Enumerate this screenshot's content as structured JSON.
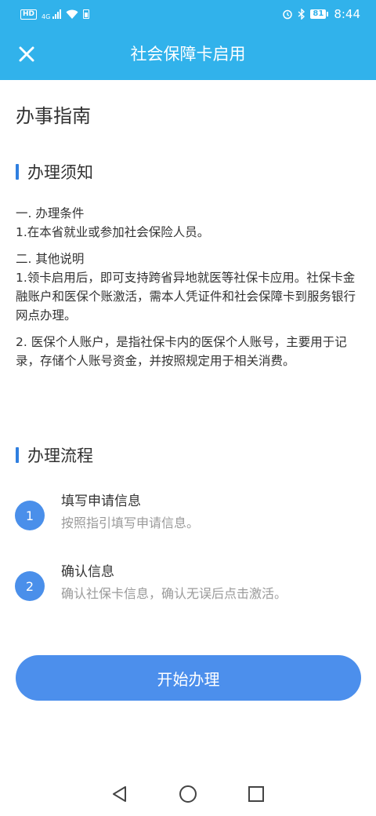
{
  "status_bar": {
    "network_badge": "HD",
    "network_type": "4G",
    "battery_level": "81",
    "time": "8:44",
    "icons": [
      "hd-icon",
      "signal-icon",
      "wifi-icon",
      "battery-saver-icon",
      "alarm-icon",
      "bluetooth-icon",
      "battery-icon"
    ],
    "color": "#31b2eb"
  },
  "header": {
    "title": "社会保障卡启用",
    "close_icon": "close-icon"
  },
  "main": {
    "heading": "办事指南",
    "notice": {
      "title": "办理须知",
      "condition_heading": "一. 办理条件",
      "condition_text": "1.在本省就业或参加社会保险人员。",
      "other_heading": "二. 其他说明",
      "other_item1": "1.领卡启用后，即可支持跨省异地就医等社保卡应用。社保卡金融账户和医保个账激活，需本人凭证件和社会保障卡到服务银行网点办理。",
      "other_item2": "2. 医保个人账户，是指社保卡内的医保个人账号，主要用于记录，存储个人账号资金，并按照规定用于相关消费。"
    },
    "process": {
      "title": "办理流程",
      "steps": [
        {
          "number": "1",
          "title": "填写申请信息",
          "desc": "按照指引填写申请信息。"
        },
        {
          "number": "2",
          "title": "确认信息",
          "desc": "确认社保卡信息，确认无误后点击激活。"
        }
      ]
    },
    "start_button": "开始办理",
    "accent_color": "#4c8fec"
  },
  "system_nav": {
    "icons": [
      "back-icon",
      "home-icon",
      "recents-icon"
    ]
  }
}
